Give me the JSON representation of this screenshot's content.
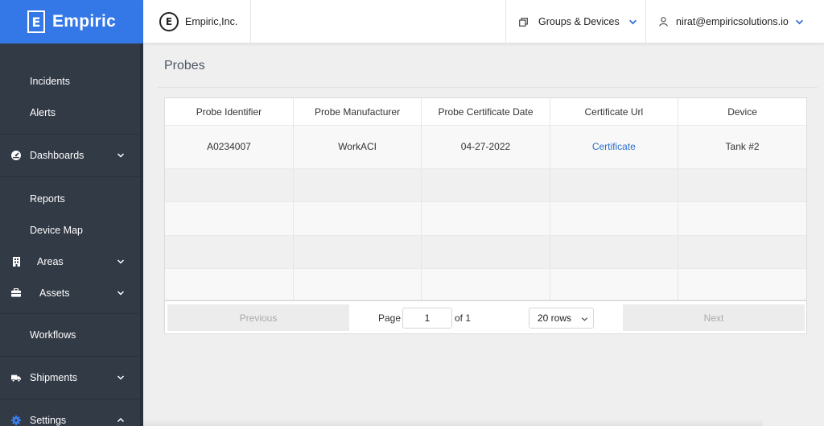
{
  "brand": {
    "name": "Empiric",
    "logo_letter": "E"
  },
  "header": {
    "company_name": "Empiric,Inc.",
    "company_logo_letter": "E",
    "groups_label": "Groups & Devices",
    "user_email": "nirat@empiricsolutions.io"
  },
  "sidebar": {
    "items": [
      {
        "label": "Incidents"
      },
      {
        "label": "Alerts"
      },
      {
        "label": "Dashboards"
      },
      {
        "label": "Reports"
      },
      {
        "label": "Device Map"
      },
      {
        "label": "Areas"
      },
      {
        "label": "Assets"
      },
      {
        "label": "Workflows"
      },
      {
        "label": "Shipments"
      },
      {
        "label": "Settings"
      }
    ]
  },
  "main": {
    "title": "Probes",
    "table": {
      "columns": [
        "Probe Identifier",
        "Probe Manufacturer",
        "Probe Certificate Date",
        "Certificate Url",
        "Device"
      ],
      "rows": [
        {
          "probe_id": "A0234007",
          "manufacturer": "WorkACI",
          "cert_date": "04-27-2022",
          "cert_url": "Certificate",
          "device": "Tank #2"
        }
      ]
    },
    "pagination": {
      "previous_label": "Previous",
      "page_label": "Page",
      "current_page": "1",
      "of_label": "of 1",
      "rows_selected": "20 rows",
      "next_label": "Next"
    }
  },
  "colors": {
    "brand_blue": "#3478e8",
    "sidebar_bg": "#323a46",
    "link_blue": "#2a6fcf",
    "accent_chevron": "#2f6fd6"
  },
  "icons": {
    "header_groups": "windows-stack-icon",
    "header_user": "user-icon",
    "dashboards": "gauge-icon",
    "areas": "building-icon",
    "assets": "briefcase-icon",
    "shipments": "truck-icon",
    "settings": "gear-icon"
  }
}
